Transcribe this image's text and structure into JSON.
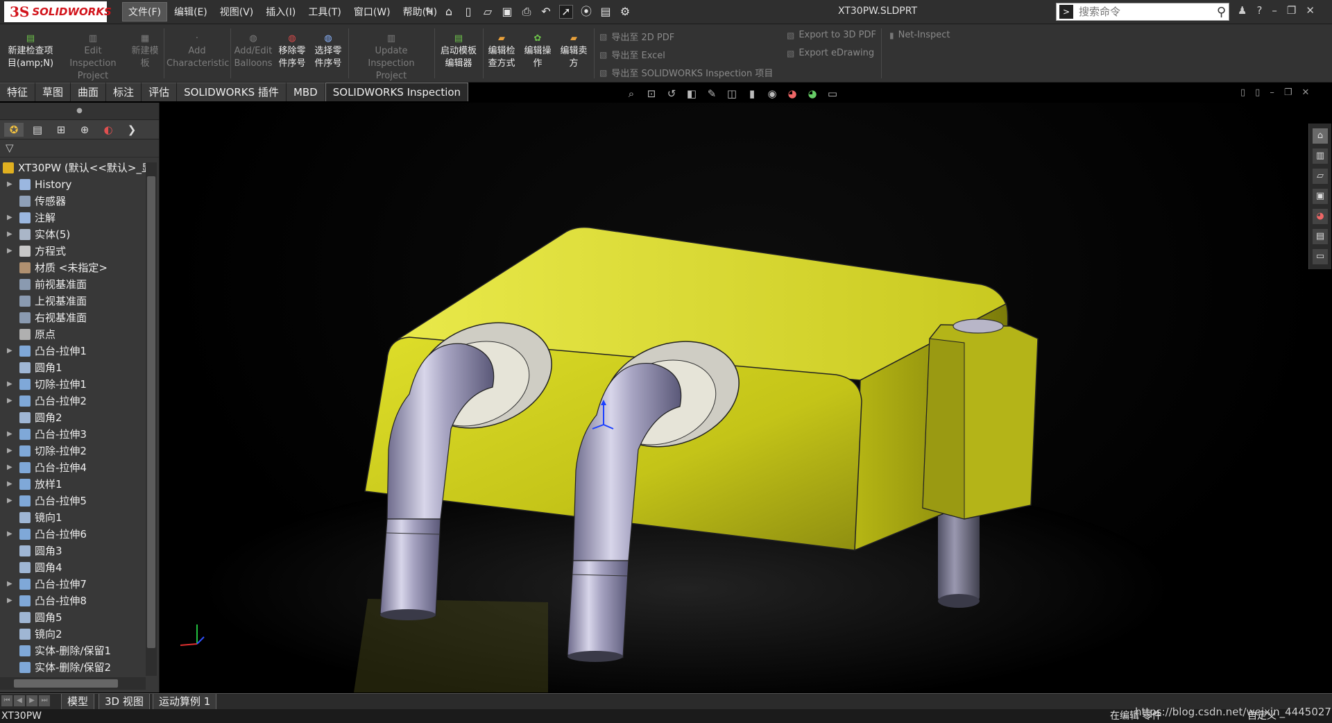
{
  "app": {
    "logo_ds": "3S",
    "logo_text": "SOLIDWORKS"
  },
  "menu": [
    "文件(F)",
    "编辑(E)",
    "视图(V)",
    "插入(I)",
    "工具(T)",
    "窗口(W)",
    "帮助(H)"
  ],
  "document_title": "XT30PW.SLDPRT",
  "search": {
    "placeholder": "搜索命令"
  },
  "commands": [
    {
      "label": "新建检查项\n目(amp;N)",
      "enabled": true
    },
    {
      "label": "Edit Inspection\nProject",
      "enabled": false
    },
    {
      "label": "新建模\n板",
      "enabled": false
    },
    {
      "label": "Add\nCharacteristic",
      "enabled": false
    },
    {
      "label": "Add/Edit\nBalloons",
      "enabled": false
    },
    {
      "label": "移除零\n件序号",
      "enabled": true
    },
    {
      "label": "选择零\n件序号",
      "enabled": true
    },
    {
      "label": "Update Inspection\nProject",
      "enabled": false
    },
    {
      "label": "启动模板\n编辑器",
      "enabled": true
    },
    {
      "label": "编辑检\n查方式",
      "enabled": true
    },
    {
      "label": "编辑操\n作",
      "enabled": true
    },
    {
      "label": "编辑卖\n方",
      "enabled": true
    }
  ],
  "exports": [
    "导出至 2D PDF",
    "导出至 Excel",
    "导出至 SOLIDWORKS Inspection 项目",
    "Export to 3D PDF",
    "Export eDrawing",
    "Net-Inspect"
  ],
  "tabs": [
    "特征",
    "草图",
    "曲面",
    "标注",
    "评估",
    "SOLIDWORKS 插件",
    "MBD",
    "SOLIDWORKS Inspection"
  ],
  "active_tab": "SOLIDWORKS Inspection",
  "tree": {
    "root": "XT30PW  (默认<<默认>_显",
    "items": [
      {
        "label": "History",
        "expandable": true,
        "icon": "history-icon"
      },
      {
        "label": "传感器",
        "expandable": false,
        "icon": "sensor-icon"
      },
      {
        "label": "注解",
        "expandable": true,
        "icon": "annotation-icon"
      },
      {
        "label": "实体(5)",
        "expandable": true,
        "icon": "solid-bodies-icon"
      },
      {
        "label": "方程式",
        "expandable": true,
        "icon": "equations-icon"
      },
      {
        "label": "材质 <未指定>",
        "expandable": false,
        "icon": "material-icon"
      },
      {
        "label": "前视基准面",
        "expandable": false,
        "icon": "plane-icon"
      },
      {
        "label": "上视基准面",
        "expandable": false,
        "icon": "plane-icon"
      },
      {
        "label": "右视基准面",
        "expandable": false,
        "icon": "plane-icon"
      },
      {
        "label": "原点",
        "expandable": false,
        "icon": "origin-icon"
      },
      {
        "label": "凸台-拉伸1",
        "expandable": true,
        "icon": "boss-extrude-icon"
      },
      {
        "label": "圆角1",
        "expandable": false,
        "icon": "fillet-icon"
      },
      {
        "label": "切除-拉伸1",
        "expandable": true,
        "icon": "cut-extrude-icon"
      },
      {
        "label": "凸台-拉伸2",
        "expandable": true,
        "icon": "boss-extrude-icon"
      },
      {
        "label": "圆角2",
        "expandable": false,
        "icon": "fillet-icon"
      },
      {
        "label": "凸台-拉伸3",
        "expandable": true,
        "icon": "boss-extrude-icon"
      },
      {
        "label": "切除-拉伸2",
        "expandable": true,
        "icon": "cut-extrude-icon"
      },
      {
        "label": "凸台-拉伸4",
        "expandable": true,
        "icon": "boss-extrude-icon"
      },
      {
        "label": "放样1",
        "expandable": true,
        "icon": "loft-icon"
      },
      {
        "label": "凸台-拉伸5",
        "expandable": true,
        "icon": "boss-extrude-icon"
      },
      {
        "label": "镜向1",
        "expandable": false,
        "icon": "mirror-icon"
      },
      {
        "label": "凸台-拉伸6",
        "expandable": true,
        "icon": "boss-extrude-icon"
      },
      {
        "label": "圆角3",
        "expandable": false,
        "icon": "fillet-icon"
      },
      {
        "label": "圆角4",
        "expandable": false,
        "icon": "fillet-icon"
      },
      {
        "label": "凸台-拉伸7",
        "expandable": true,
        "icon": "boss-extrude-icon"
      },
      {
        "label": "凸台-拉伸8",
        "expandable": true,
        "icon": "boss-extrude-icon"
      },
      {
        "label": "圆角5",
        "expandable": false,
        "icon": "fillet-icon"
      },
      {
        "label": "镜向2",
        "expandable": false,
        "icon": "mirror-icon"
      },
      {
        "label": "实体-删除/保留1",
        "expandable": false,
        "icon": "body-delete-icon"
      },
      {
        "label": "实体-删除/保留2",
        "expandable": false,
        "icon": "body-delete-icon"
      }
    ]
  },
  "bottom_tabs": [
    "模型",
    "3D 视图",
    "运动算例 1"
  ],
  "status": {
    "filename": "XT30PW",
    "editing": "在编辑 零件",
    "custom": "自定义",
    "watermark": "https://blog.csdn.net/weixin_44450279"
  },
  "colors": {
    "body_yellow": "#d9d91f",
    "pipe_gray": "#a9a6c3",
    "background": "#000000",
    "ui_dark": "#333333"
  }
}
